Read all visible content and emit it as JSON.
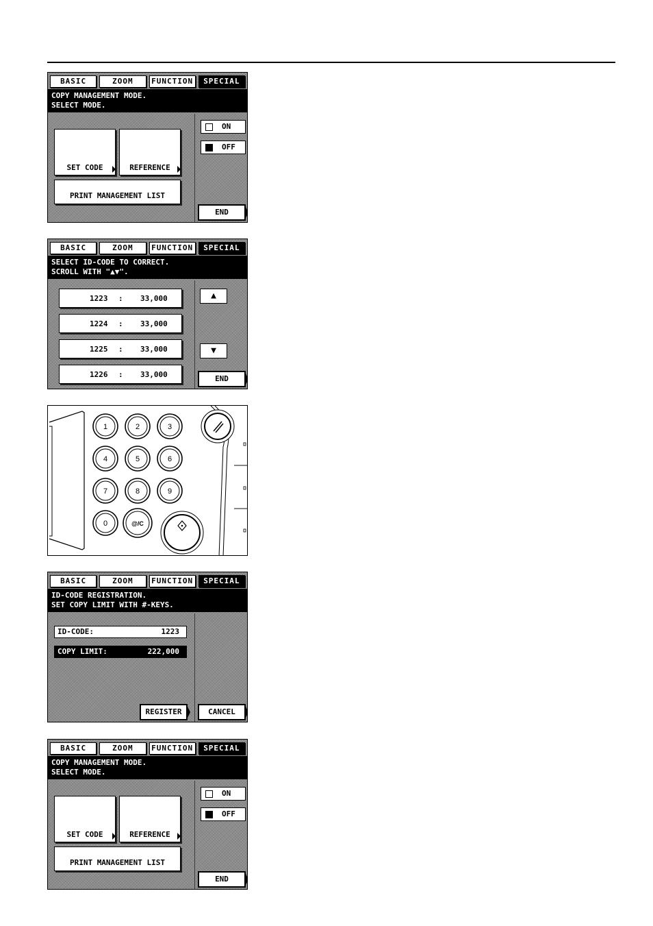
{
  "tabs": [
    "BASIC",
    "ZOOM",
    "FUNCTION",
    "SPECIAL"
  ],
  "screen1": {
    "message": [
      "COPY MANAGEMENT MODE.",
      "SELECT MODE."
    ],
    "set_code": "SET CODE",
    "reference": "REFERENCE",
    "print_list": "PRINT MANAGEMENT LIST",
    "on": "ON",
    "off": "OFF",
    "end": "END"
  },
  "screen2": {
    "message": [
      "SELECT ID-CODE TO CORRECT.",
      "SCROLL WITH \"▲▼\"."
    ],
    "rows": [
      {
        "code": "1223",
        "sep": ":",
        "limit": "33,000"
      },
      {
        "code": "1224",
        "sep": ":",
        "limit": "33,000"
      },
      {
        "code": "1225",
        "sep": ":",
        "limit": "33,000"
      },
      {
        "code": "1226",
        "sep": ":",
        "limit": "33,000"
      }
    ],
    "up": "▲",
    "down": "▼",
    "end": "END"
  },
  "keypad": {
    "keys": [
      "1",
      "2",
      "3",
      "4",
      "5",
      "6",
      "7",
      "8",
      "9",
      "0",
      "@/C"
    ],
    "reset_icon": "reset-icon",
    "start_icon": "start-icon"
  },
  "screen4": {
    "message": [
      "ID-CODE REGISTRATION.",
      "SET COPY LIMIT WITH #-KEYS."
    ],
    "id_label": "ID-CODE:",
    "id_value": "1223",
    "limit_label": "COPY LIMIT:",
    "limit_value": "222,000",
    "register": "REGISTER",
    "cancel": "CANCEL"
  },
  "screen5": {
    "message": [
      "COPY MANAGEMENT MODE.",
      "SELECT MODE."
    ],
    "set_code": "SET CODE",
    "reference": "REFERENCE",
    "print_list": "PRINT MANAGEMENT LIST",
    "on": "ON",
    "off": "OFF",
    "end": "END"
  }
}
